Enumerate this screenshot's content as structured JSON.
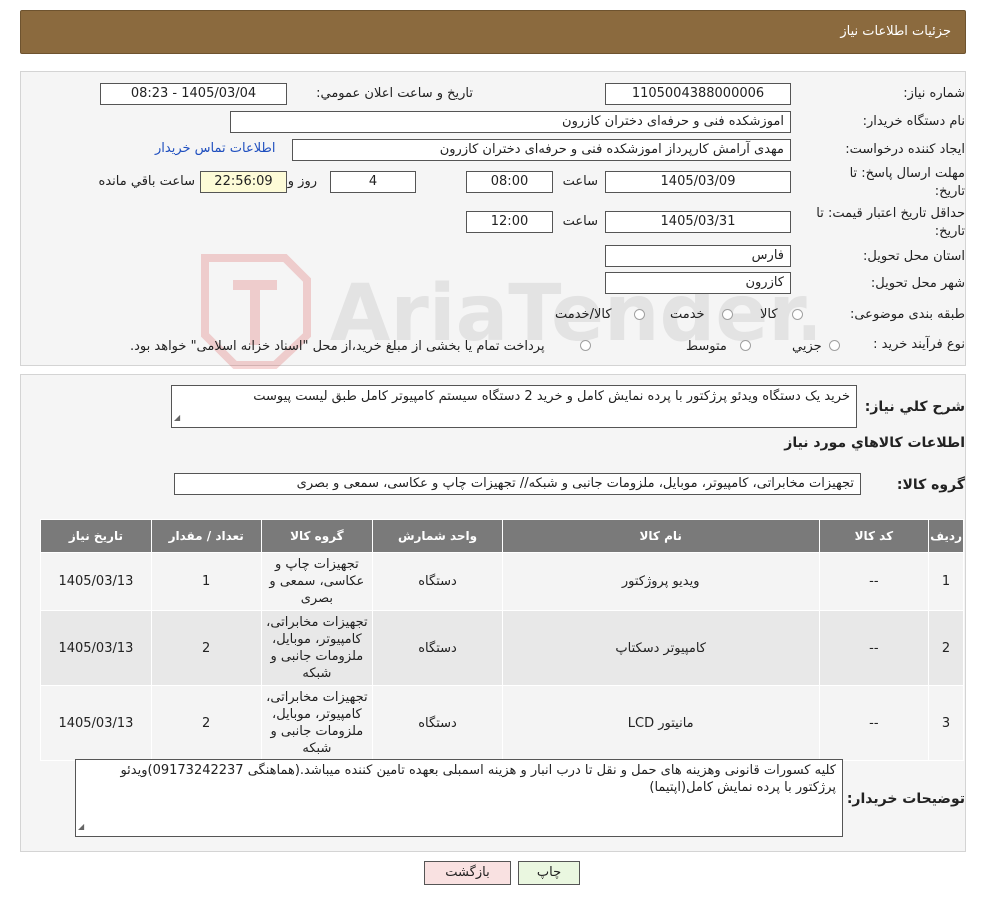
{
  "header": {
    "title": "جزئیات اطلاعات نیاز"
  },
  "form": {
    "need_number_label": "شماره نیاز:",
    "need_number": "1105004388000006",
    "announce_label": "تاریخ و ساعت اعلان عمومي:",
    "announce_value": "1405/03/04 - 08:23",
    "buyer_org_label": "نام دستگاه خریدار:",
    "buyer_org": "اموزشکده فنی و حرفه‌ای دختران کازرون",
    "creator_label": "ایجاد کننده درخواست:",
    "creator": "مهدی آرامش کارپرداز اموزشکده فنی و حرفه‌ای دختران کازرون",
    "contact_link": "اطلاعات تماس خریدار",
    "deadline_label_1": "مهلت ارسال پاسخ: تا",
    "deadline_label_2": "تاریخ:",
    "deadline_date": "1405/03/09",
    "time_label": "ساعت",
    "deadline_time": "08:00",
    "days_value": "4",
    "days_label": "روز و",
    "remaining_time": "22:56:09",
    "remaining_label": "ساعت باقي مانده",
    "validity_label_1": "حداقل تاریخ اعتبار قیمت: تا",
    "validity_label_2": "تاریخ:",
    "validity_date": "1405/03/31",
    "validity_time": "12:00",
    "province_label": "استان محل تحویل:",
    "province": "فارس",
    "city_label": "شهر محل تحویل:",
    "city": "كازرون",
    "category_label": "طبقه بندی موضوعی:",
    "category_options": [
      "کالا",
      "خدمت",
      "کالا/خدمت"
    ],
    "process_label": "نوع فرآیند خرید :",
    "process_options": [
      "جزيي",
      "متوسط"
    ],
    "process_note": "پرداخت تمام یا بخشی از مبلغ خرید،از محل \"اسناد خزانه اسلامی\" خواهد بود."
  },
  "description": {
    "label": "شرح كلي نياز:",
    "text": "خرید یک دستگاه ویدئو پرژکتور با پرده نمایش کامل و خرید 2 دستگاه سیستم کامپیوتر کامل طبق لیست پیوست"
  },
  "goods": {
    "section_title": "اطلاعات کالاهاي مورد نياز",
    "group_label": "گروه کالا:",
    "group_value": "تجهیزات مخابراتی، کامپیوتر، موبایل، ملزومات جانبی و شبکه// تجهیزات چاپ و عکاسی، سمعی و بصری",
    "table": {
      "headers": [
        "رديف",
        "کد کالا",
        "نام کالا",
        "واحد شمارش",
        "گروه کالا",
        "تعداد / مقدار",
        "تاریخ نیاز"
      ],
      "rows": [
        [
          "1",
          "--",
          "ویدیو پروژکتور",
          "دستگاه",
          "تجهیزات چاپ و عکاسی، سمعی و بصری",
          "1",
          "1405/03/13"
        ],
        [
          "2",
          "--",
          "کامپیوتر دسکتاپ",
          "دستگاه",
          "تجهیزات مخابراتی، کامپیوتر، موبایل، ملزومات جانبی و شبکه",
          "2",
          "1405/03/13"
        ],
        [
          "3",
          "--",
          "مانیتور LCD",
          "دستگاه",
          "تجهیزات مخابراتی، کامپیوتر، موبایل، ملزومات جانبی و شبکه",
          "2",
          "1405/03/13"
        ]
      ]
    }
  },
  "buyer_notes": {
    "label": "توضیحات خریدار:",
    "text": "کلیه کسورات قانونی وهزینه های حمل و نقل تا درب انبار و هزینه اسمبلی بعهده تامین کننده میباشد.(هماهنگی 09173242237)ویدئو پرژکتور با پرده نمایش کامل(اپتیما)"
  },
  "buttons": {
    "print": "چاپ",
    "back": "بازگشت"
  },
  "watermark": {
    "text": "AriaTender.neT"
  },
  "colors": {
    "header": "#8b6a3e",
    "table_header": "#7a7a7a",
    "print_btn": "#eaf7e0",
    "back_btn": "#f9e1e1"
  }
}
